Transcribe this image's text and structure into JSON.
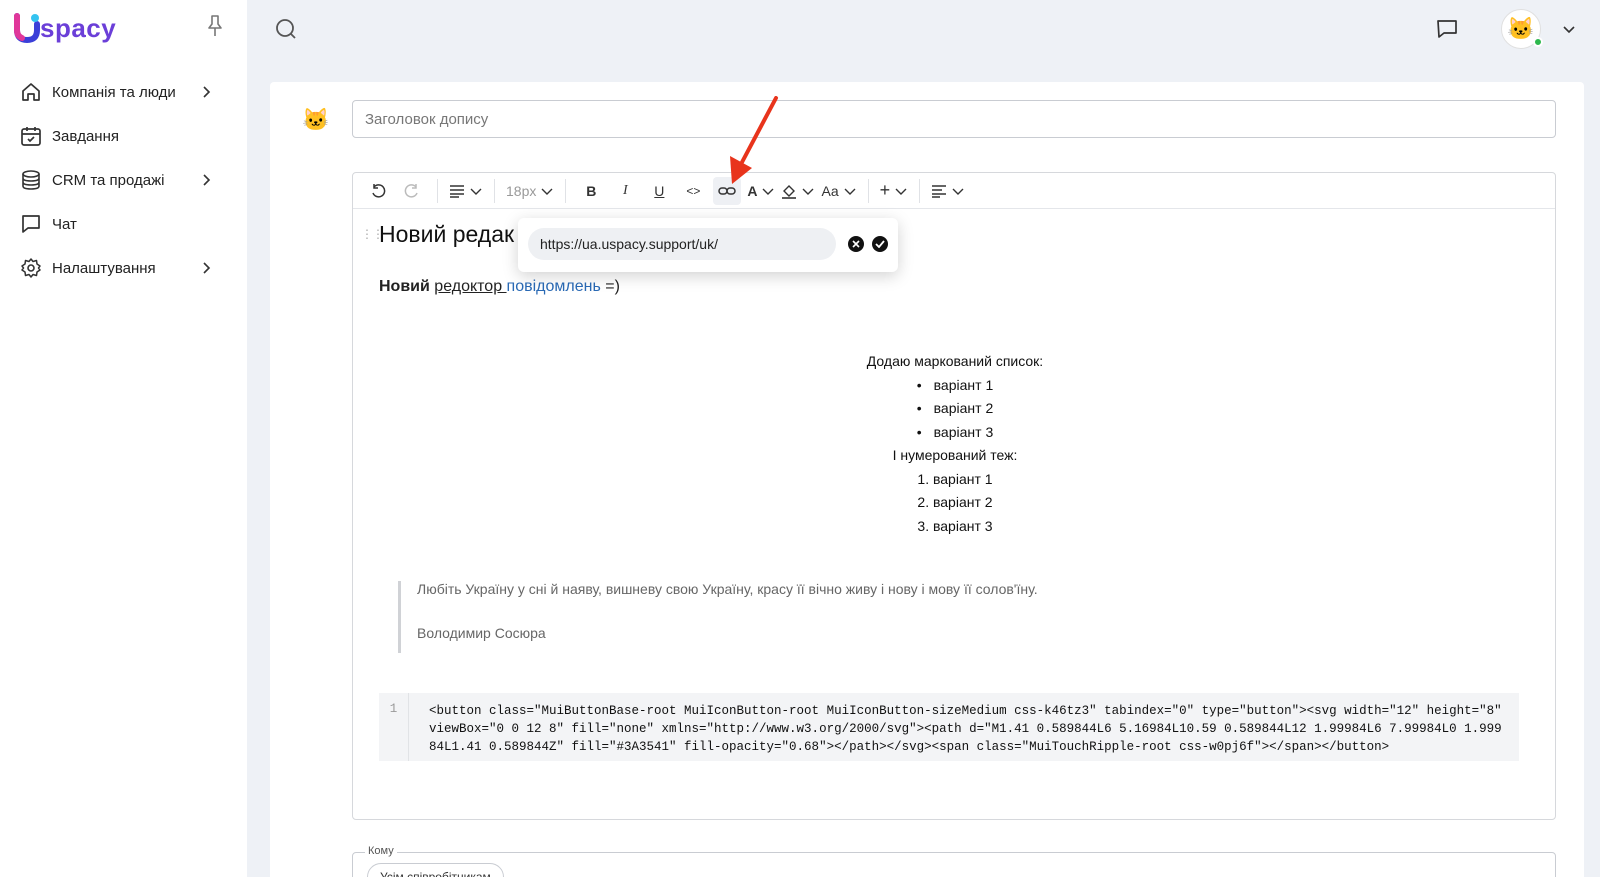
{
  "app": {
    "logo_text": "spacy",
    "brand_color": "#6b3fd8"
  },
  "sidebar": {
    "items": [
      {
        "label": "Компанія та люди",
        "icon": "home-icon",
        "has_submenu": true
      },
      {
        "label": "Завдання",
        "icon": "calendar-icon",
        "has_submenu": false
      },
      {
        "label": "CRM та продажі",
        "icon": "database-icon",
        "has_submenu": true
      },
      {
        "label": "Чат",
        "icon": "chat-icon",
        "has_submenu": false
      },
      {
        "label": "Налаштування",
        "icon": "gear-icon",
        "has_submenu": true
      }
    ]
  },
  "post": {
    "title_placeholder": "Заголовок допису",
    "title_value": ""
  },
  "toolbar": {
    "font_size": "18px",
    "bold": "B",
    "italic": "I",
    "underline": "U",
    "code": "<>",
    "font_color": "A",
    "text_case": "Aa",
    "insert": "+"
  },
  "editor": {
    "heading": "Новий редак",
    "paragraph": {
      "bold": "Новий",
      "underlined": "редоктор ",
      "link": "повідомлень",
      "tail": " =)"
    },
    "bullets_intro": "Додаю маркований список:",
    "bullets": [
      "варіант 1",
      "варіант 2",
      "варіант 3"
    ],
    "numbered_intro": "І нумерований теж:",
    "numbered": [
      "1. варіант 1",
      "2. варіант 2",
      "3. варіант 3"
    ],
    "quote": {
      "text": "Любіть Україну у сні й наяву, вишневу свою Україну, красу її вічно живу і нову і мову її солов'їну.",
      "author": "Володимир Сосюра"
    },
    "code": {
      "line_number": "1",
      "text": "<button class=\"MuiButtonBase-root MuiIconButton-root MuiIconButton-sizeMedium css-k46tz3\" tabindex=\"0\" type=\"button\"><svg width=\"12\" height=\"8\" viewBox=\"0 0 12 8\" fill=\"none\" xmlns=\"http://www.w3.org/2000/svg\"><path d=\"M1.41 0.589844L6 5.16984L10.59 0.589844L12 1.99984L6 7.99984L0 1.99984L1.41 0.589844Z\" fill=\"#3A3541\" fill-opacity=\"0.68\"></path></svg><span class=\"MuiTouchRipple-root css-w0pj6f\"></span></button>"
    }
  },
  "link_popover": {
    "url": "https://ua.uspacy.support/uk/"
  },
  "recipients": {
    "label": "Кому",
    "chip": "Усім співробітникам"
  },
  "colors": {
    "annotation_arrow": "#e8341c",
    "link": "#2a6ab5",
    "online": "#2db84d"
  }
}
